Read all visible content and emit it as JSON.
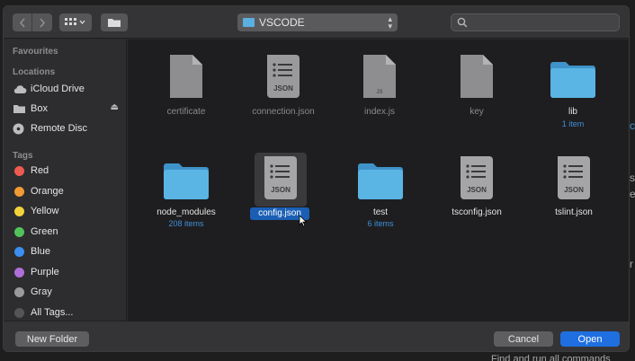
{
  "toolbar": {
    "back_icon": "chevron-left-icon",
    "forward_icon": "chevron-right-icon",
    "view_icon": "grid-view-icon",
    "new_folder_icon": "folder-icon",
    "location": "VSCODE",
    "search_placeholder": ""
  },
  "sidebar": {
    "sections": {
      "favourites": "Favourites",
      "locations": "Locations",
      "tags": "Tags"
    },
    "locations": [
      {
        "label": "iCloud Drive",
        "icon": "cloud-icon"
      },
      {
        "label": "Box",
        "icon": "folder-icon"
      },
      {
        "label": "Remote Disc",
        "icon": "disc-icon"
      }
    ],
    "tags": [
      {
        "label": "Red",
        "color": "#ef5a50"
      },
      {
        "label": "Orange",
        "color": "#f39a34"
      },
      {
        "label": "Yellow",
        "color": "#f2d23a"
      },
      {
        "label": "Green",
        "color": "#51c35a"
      },
      {
        "label": "Blue",
        "color": "#3b8ff2"
      },
      {
        "label": "Purple",
        "color": "#b06fd8"
      },
      {
        "label": "Gray",
        "color": "#9a9a9c"
      },
      {
        "label": "All Tags...",
        "color": "#555557"
      }
    ]
  },
  "files": [
    {
      "name": "certificate",
      "type": "doc",
      "dimmed": true
    },
    {
      "name": "connection.json",
      "type": "json",
      "dimmed": true
    },
    {
      "name": "index.js",
      "type": "js",
      "dimmed": true
    },
    {
      "name": "key",
      "type": "doc",
      "dimmed": true
    },
    {
      "name": "lib",
      "type": "folder",
      "items": "1 item"
    },
    {
      "name": "node_modules",
      "type": "folder",
      "items": "208 items"
    },
    {
      "name": "config.json",
      "type": "json",
      "selected": true
    },
    {
      "name": "test",
      "type": "folder",
      "items": "6 items"
    },
    {
      "name": "tsconfig.json",
      "type": "json"
    },
    {
      "name": "tslint.json",
      "type": "json"
    }
  ],
  "file_icon_labels": {
    "json": "JSON",
    "js": "JS"
  },
  "footer": {
    "new_folder": "New Folder",
    "cancel": "Cancel",
    "open": "Open"
  },
  "background": {
    "frag1": "c",
    "frag2": "s",
    "frag3": "e",
    "frag4": "r",
    "frag5": "Find and run all commands"
  },
  "colors": {
    "accent": "#1f6fe0",
    "folder": "#5ab4e4",
    "link": "#3f8fd6"
  }
}
